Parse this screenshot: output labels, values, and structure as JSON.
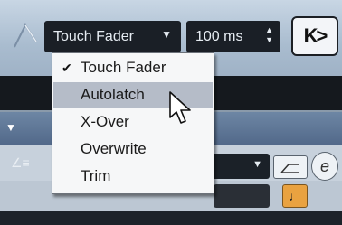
{
  "toolbar": {
    "mode_select": {
      "value": "Touch Fader",
      "icon": "chevron-down-icon"
    },
    "time_field": {
      "value": "100 ms",
      "icon": "up-down-spinner-icon"
    },
    "nav_button": {
      "label": "K>"
    },
    "ramp_icon": "ramp-icon"
  },
  "menu": {
    "items": [
      {
        "label": "Touch Fader",
        "checked": true,
        "highlighted": false
      },
      {
        "label": "Autolatch",
        "checked": false,
        "highlighted": true
      },
      {
        "label": "X-Over",
        "checked": false,
        "highlighted": false
      },
      {
        "label": "Overwrite",
        "checked": false,
        "highlighted": false
      },
      {
        "label": "Trim",
        "checked": false,
        "highlighted": false
      }
    ]
  },
  "panel": {
    "envelope_button_icon": "envelope-icon",
    "edit_button_label": "e",
    "music_button_icon": "music-note-icon"
  },
  "colors": {
    "menu_highlight": "#b5bcc8",
    "field_bg": "#1a1f26",
    "accent_orange": "#e9a240"
  }
}
